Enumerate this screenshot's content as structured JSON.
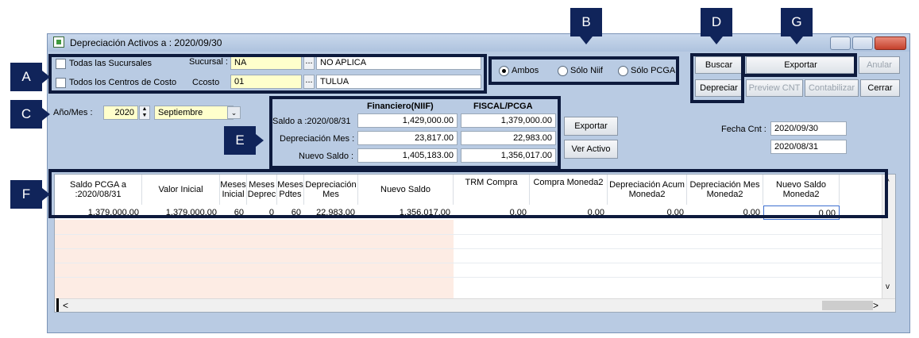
{
  "window": {
    "title": "Depreciación Activos  a : 2020/09/30"
  },
  "filters": {
    "todas_sucursales": "Todas las Sucursales",
    "todos_centros": "Todos los Centros de Costo",
    "sucursal_label": "Sucursal :",
    "sucursal_code": "NA",
    "sucursal_name": "NO APLICA",
    "ccosto_label": "Ccosto",
    "ccosto_code": "01",
    "ccosto_name": "TULUA",
    "ellipsis": "..."
  },
  "mode": {
    "ambos": "Ambos",
    "solo_niif": "Sólo Niif",
    "solo_pcga": "Sólo PCGA",
    "selected": "Ambos"
  },
  "buttons": {
    "buscar": "Buscar",
    "exportar_top": "Exportar",
    "anular": "Anular",
    "depreciar": "Depreciar",
    "preview": "Preview CNT",
    "contabilizar": "Contabilizar",
    "cerrar": "Cerrar",
    "exportar_mid": "Exportar",
    "ver_activo": "Ver Activo"
  },
  "period": {
    "label": "Año/Mes :",
    "year": "2020",
    "month": "Septiembre"
  },
  "summary": {
    "col_financiero": "Financiero(NIIF)",
    "col_fiscal": "FISCAL/PCGA",
    "saldo_label": "Saldo a :2020/08/31",
    "dep_label": "Depreciación Mes :",
    "nuevo_label": "Nuevo Saldo :",
    "saldo_niif": "1,429,000.00",
    "saldo_pcga": "1,379,000.00",
    "dep_niif": "23,817.00",
    "dep_pcga": "22,983.00",
    "nuevo_niif": "1,405,183.00",
    "nuevo_pcga": "1,356,017.00"
  },
  "fecha": {
    "label": "Fecha Cnt :",
    "value1": "2020/09/30",
    "value2": "2020/08/31"
  },
  "annotations": {
    "A": "A",
    "B": "B",
    "C": "C",
    "D": "D",
    "E": "E",
    "F": "F",
    "G": "G"
  },
  "table": {
    "headers": [
      "Saldo PCGA a :2020/08/31",
      "Valor Inicial",
      "Meses Inicial",
      "Meses Deprec",
      "Meses Pdtes",
      "Depreciación Mes",
      "Nuevo Saldo",
      "TRM Compra",
      "Compra Moneda2",
      "Depreciación Acum Moneda2",
      "Depreciación Mes Moneda2",
      "Nuevo Saldo Moneda2"
    ],
    "row": [
      "1,379,000.00",
      "1,379,000.00",
      "60",
      "0",
      "60",
      "22,983.00",
      "1,356,017.00",
      "0.00",
      "0.00",
      "0.00",
      "0.00",
      "0.00"
    ]
  },
  "scroll": {
    "left_arrow": "<",
    "right_arrow": ">",
    "up_arrow": "^",
    "down_arrow": "v"
  }
}
